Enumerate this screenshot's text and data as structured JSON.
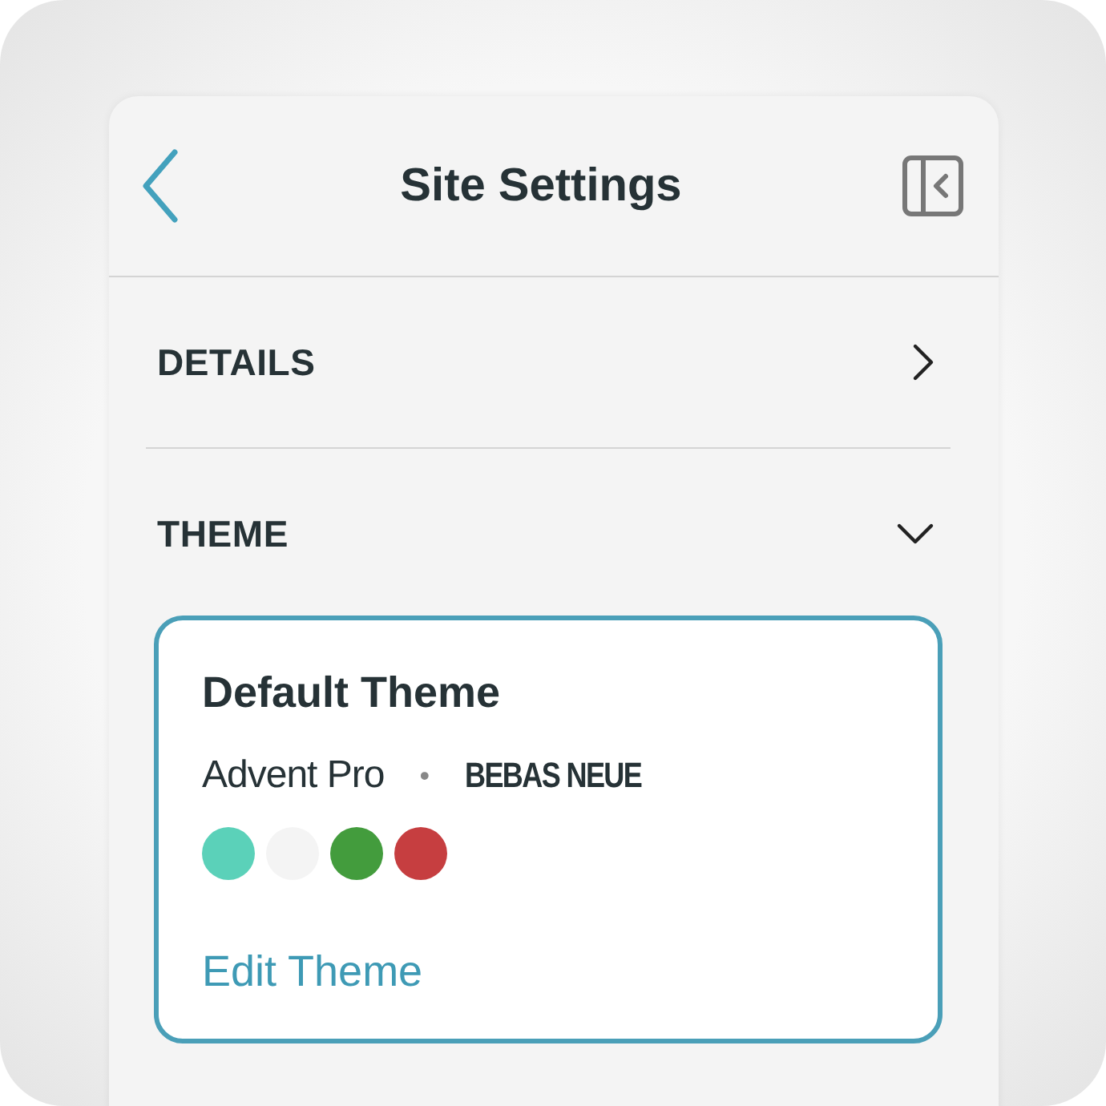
{
  "header": {
    "title": "Site Settings"
  },
  "sections": [
    {
      "label": "DETAILS",
      "expanded": false
    },
    {
      "label": "THEME",
      "expanded": true
    }
  ],
  "theme_card": {
    "title": "Default Theme",
    "fonts": [
      {
        "name": "Advent Pro",
        "kind": "light"
      },
      {
        "name": "BEBAS NEUE",
        "kind": "display"
      }
    ],
    "separator": "•",
    "swatches": [
      {
        "color": "#5bd1b9"
      },
      {
        "color": "#f4f4f4"
      },
      {
        "color": "#439c3d"
      },
      {
        "color": "#c63e40"
      }
    ],
    "link": "Edit Theme"
  }
}
